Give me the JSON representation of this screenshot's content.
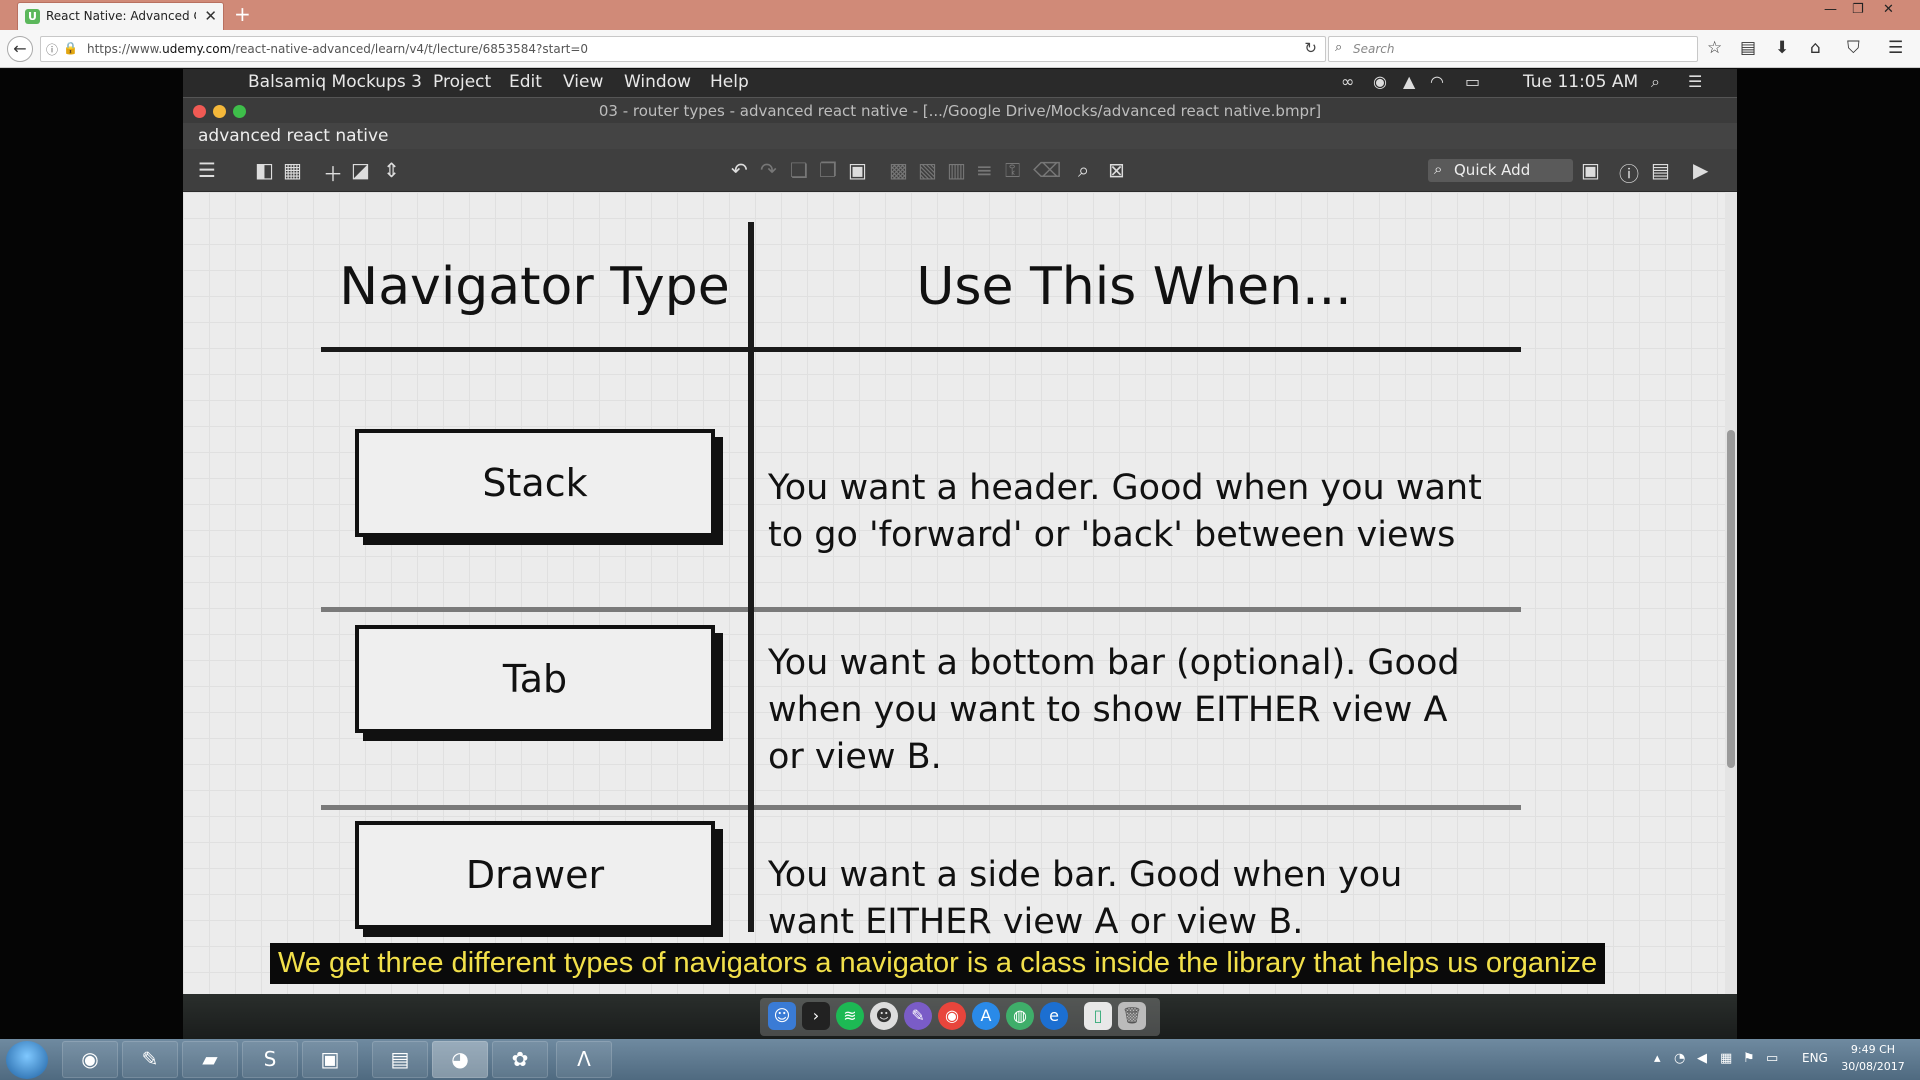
{
  "browser": {
    "tab_title": "React Native: Advanced Con",
    "tab_favicon": "U",
    "url_prefix": "https://www.",
    "url_domain": "udemy.com",
    "url_path": "/react-native-advanced/learn/v4/t/lecture/6853584?start=0",
    "search_placeholder": "Search",
    "icons": [
      "back-arrow-icon",
      "info-icon",
      "lock-icon",
      "reload-icon",
      "search-icon",
      "bookmark-star-icon",
      "reading-list-icon",
      "download-icon",
      "home-icon",
      "pocket-icon",
      "hamburger-menu-icon"
    ]
  },
  "mac": {
    "menu": [
      "Balsamiq Mockups 3",
      "Project",
      "Edit",
      "View",
      "Window",
      "Help"
    ],
    "clock": "Tue 11:05 AM",
    "window_title": "03 - router types - advanced react native - [.../Google Drive/Mocks/advanced react native.bmpr]",
    "project_name": "advanced react native"
  },
  "toolbar": {
    "quick_add_label": "Quick Add"
  },
  "mockup": {
    "header_left": "Navigator Type",
    "header_right": "Use This When...",
    "rows": [
      {
        "button": "Stack",
        "desc_line1": "You want a header. Good when you want",
        "desc_line2": "to go 'forward' or 'back' between views",
        "desc_line3": ""
      },
      {
        "button": "Tab",
        "desc_line1": "You want a bottom bar (optional).  Good",
        "desc_line2": "when you want to show EITHER view A",
        "desc_line3": "or view B."
      },
      {
        "button": "Drawer",
        "desc_line1": "You want a side bar.  Good when you",
        "desc_line2": "want EITHER view A or view B.",
        "desc_line3": ""
      }
    ]
  },
  "subtitle": "We get three different types of navigators a navigator is a class inside the library that helps us organize",
  "taskbar": {
    "lang": "ENG",
    "time": "9:49 CH",
    "date": "30/08/2017"
  },
  "colors": {
    "tab_bar": "#d08a78",
    "subtitle_text": "#f2e04a",
    "canvas_bg": "#ececec"
  }
}
